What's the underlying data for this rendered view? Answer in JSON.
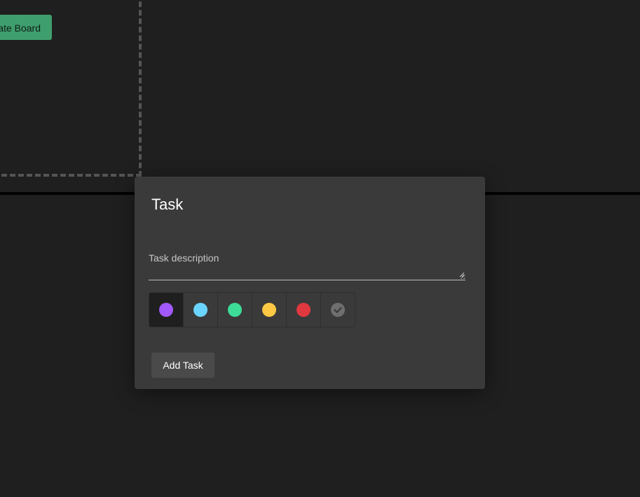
{
  "board": {
    "create_button_label": "Create Board"
  },
  "task_modal": {
    "title": "Task",
    "description": {
      "value": "",
      "placeholder": "Task description"
    },
    "colors": [
      {
        "name": "purple",
        "hex": "#a259ff",
        "selected": true
      },
      {
        "name": "blue",
        "hex": "#6bd5ff",
        "selected": false
      },
      {
        "name": "green",
        "hex": "#3ddc97",
        "selected": false
      },
      {
        "name": "yellow",
        "hex": "#ffc844",
        "selected": false
      },
      {
        "name": "red",
        "hex": "#e0383e",
        "selected": false
      },
      {
        "name": "done",
        "icon": "check-circle-icon",
        "hex": "#6f6f6f",
        "selected": false
      }
    ],
    "add_button_label": "Add Task"
  }
}
